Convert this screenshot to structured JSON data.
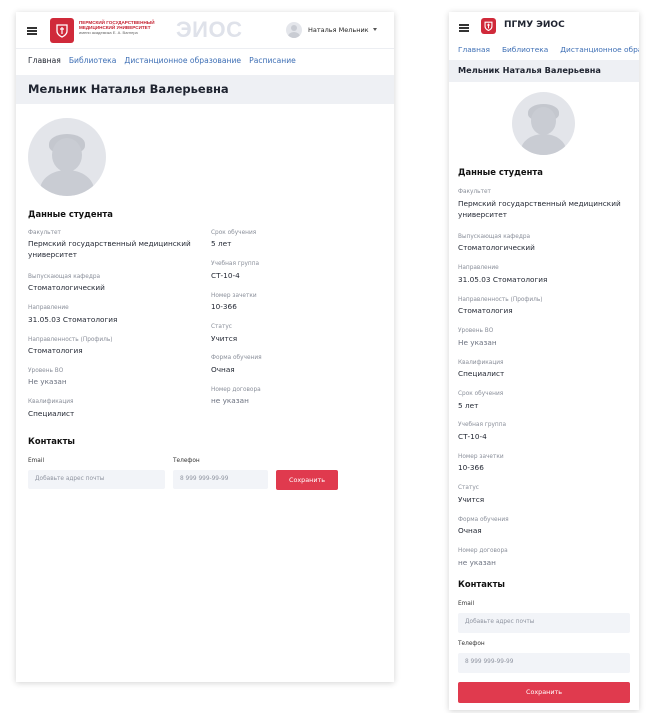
{
  "desktop": {
    "header": {
      "uni_line1": "ПЕРМСКИЙ ГОСУДАРСТВЕННЫЙ",
      "uni_line2": "МЕДИЦИНСКИЙ УНИВЕРСИТЕТ",
      "uni_sub": "имени академика Е. А. Вагнера",
      "system_name": "ЭИОС",
      "user_name": "Наталья Мельник"
    },
    "nav": [
      "Главная",
      "Библиотека",
      "Дистанционное образование",
      "Расписание"
    ],
    "page_title": "Мельник Наталья Валерьевна",
    "student_section_title": "Данные студента",
    "fields_left": [
      {
        "label": "Факультет",
        "value": "Пермский государственный медицинский университет"
      },
      {
        "label": "Выпускающая кафедра",
        "value": "Стоматологический"
      },
      {
        "label": "Направление",
        "value": "31.05.03 Стоматология"
      },
      {
        "label": "Направленность (Профиль)",
        "value": "Стоматология"
      },
      {
        "label": "Уровень ВО",
        "value": "Не указан"
      },
      {
        "label": "Квалификация",
        "value": "Специалист"
      }
    ],
    "fields_right": [
      {
        "label": "Срок обучения",
        "value": "5 лет"
      },
      {
        "label": "Учебная группа",
        "value": "СТ-10-4"
      },
      {
        "label": "Номер зачетки",
        "value": "10-366"
      },
      {
        "label": "Статус",
        "value": "Учится"
      },
      {
        "label": "Форма обучения",
        "value": "Очная"
      },
      {
        "label": "Номер договора",
        "value": "не указан"
      }
    ],
    "contacts": {
      "title": "Контакты",
      "email_label": "Email",
      "email_placeholder": "Добавьте адрес почты",
      "phone_label": "Телефон",
      "phone_placeholder": "8 999 999-99-99",
      "save_label": "Сохранить"
    }
  },
  "mobile": {
    "brand": "ПГМУ ЭИОС",
    "nav": [
      "Главная",
      "Библиотека",
      "Дистанционное образование"
    ],
    "page_title": "Мельник Наталья Валерьевна",
    "student_section_title": "Данные студента",
    "fields": [
      {
        "label": "Факультет",
        "value": "Пермский государственный медицинский университет"
      },
      {
        "label": "Выпускающая кафедра",
        "value": "Стоматологический"
      },
      {
        "label": "Направление",
        "value": "31.05.03 Стоматология"
      },
      {
        "label": "Направленность (Профиль)",
        "value": "Стоматология"
      },
      {
        "label": "Уровень ВО",
        "value": "Не указан"
      },
      {
        "label": "Квалификация",
        "value": "Специалист"
      },
      {
        "label": "Срок обучения",
        "value": "5 лет"
      },
      {
        "label": "Учебная группа",
        "value": "СТ-10-4"
      },
      {
        "label": "Номер зачетки",
        "value": "10-366"
      },
      {
        "label": "Статус",
        "value": "Учится"
      },
      {
        "label": "Форма обучения",
        "value": "Очная"
      },
      {
        "label": "Номер договора",
        "value": "не указан"
      }
    ],
    "contacts": {
      "title": "Контакты",
      "email_label": "Email",
      "email_placeholder": "Добавьте адрес почты",
      "phone_label": "Телефон",
      "phone_placeholder": "8 999 999-99-99",
      "save_label": "Сохранить"
    }
  },
  "colors": {
    "brand_red": "#d02a3a",
    "button_red": "#e03a4e",
    "link_blue": "#3e6fb5",
    "title_bar_bg": "#eef0f4"
  }
}
